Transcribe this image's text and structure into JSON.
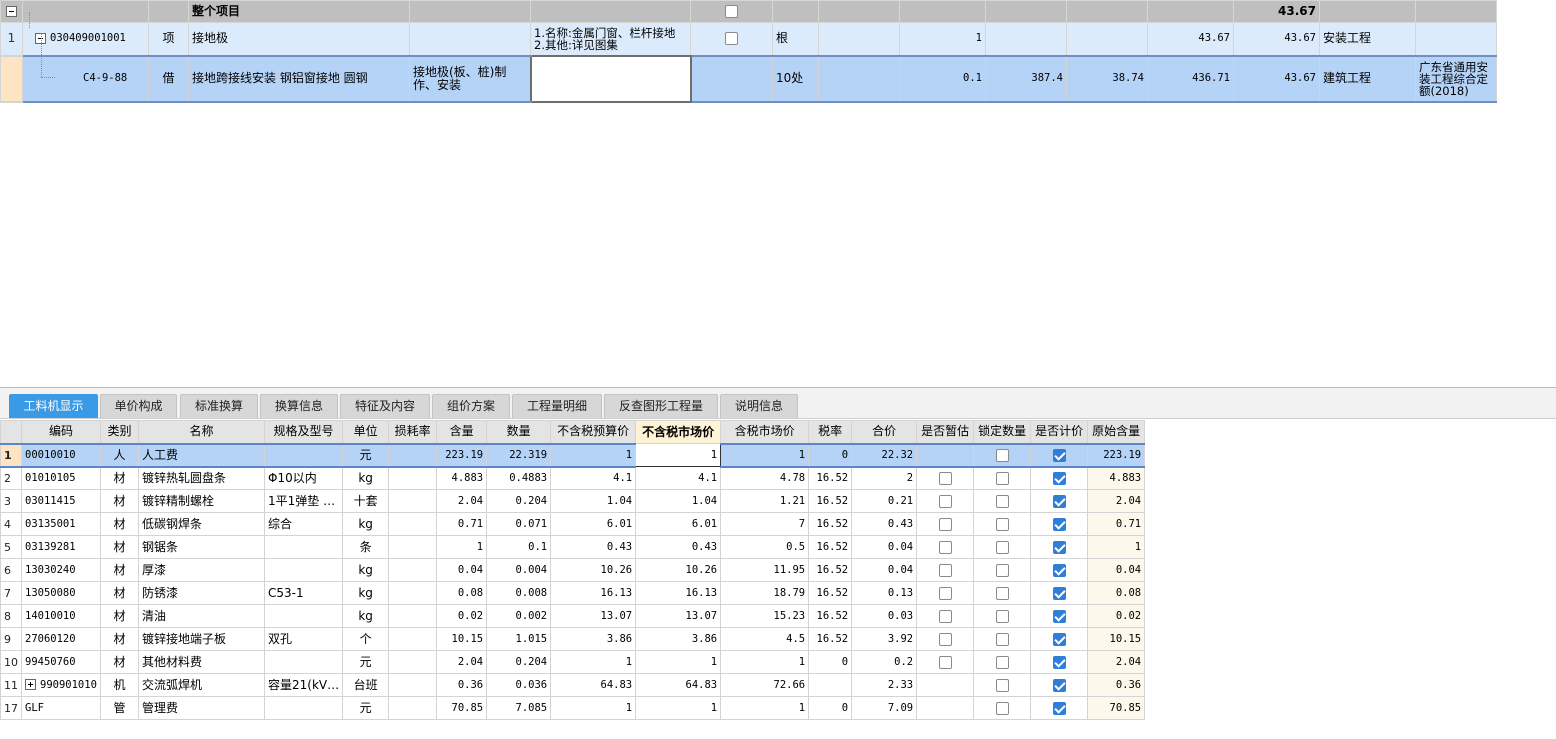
{
  "top_grid": {
    "rows": [
      {
        "index": "",
        "code": "",
        "type": "",
        "name": "整个项目",
        "content": "",
        "feature": "",
        "checked": false,
        "unit": "",
        "c8": "",
        "qty": "",
        "c10": "",
        "c11": "",
        "c12": "",
        "c13": "43.67",
        "category": "",
        "quota": ""
      },
      {
        "index": "1",
        "code": "030409001001",
        "type": "项",
        "name": "接地极",
        "content": "",
        "feature": "1.名称:金属门窗、栏杆接地\n2.其他:详见图集",
        "checked": false,
        "unit": "根",
        "c8": "",
        "qty": "1",
        "c10": "",
        "c11": "",
        "c12": "43.67",
        "c13": "43.67",
        "category": "安装工程",
        "quota": ""
      },
      {
        "index": "",
        "code": "C4-9-88",
        "type": "借",
        "name": "接地跨接线安装 钢铝窗接地 圆钢",
        "content": "接地极(板、桩)制作、安装",
        "feature": "",
        "unit": "10处",
        "c8": "",
        "qty": "0.1",
        "c10": "387.4",
        "c11": "38.74",
        "c12": "436.71",
        "c13": "43.67",
        "category": "建筑工程",
        "quota": "广东省通用安装工程综合定额(2018)"
      }
    ]
  },
  "tabs": [
    "工料机显示",
    "单价构成",
    "标准换算",
    "换算信息",
    "特征及内容",
    "组价方案",
    "工程量明细",
    "反查图形工程量",
    "说明信息"
  ],
  "bottom_grid": {
    "headers": [
      "编码",
      "类别",
      "名称",
      "规格及型号",
      "单位",
      "损耗率",
      "含量",
      "数量",
      "不含税预算价",
      "不含税市场价",
      "含税市场价",
      "税率",
      "合价",
      "是否暂估",
      "锁定数量",
      "是否计价",
      "原始含量"
    ],
    "rows": [
      {
        "idx": "1",
        "code": "00010010",
        "cat": "人",
        "name": "人工费",
        "spec": "",
        "unit": "元",
        "loss": "",
        "content": "223.19",
        "qty": "22.319",
        "budget": "1",
        "market": "1",
        "tax_market": "1",
        "rate": "0",
        "total": "22.32",
        "est": null,
        "lock": false,
        "priced": true,
        "orig": "223.19"
      },
      {
        "idx": "2",
        "code": "01010105",
        "cat": "材",
        "name": "镀锌热轧圆盘条",
        "spec": "Φ10以内",
        "unit": "kg",
        "loss": "",
        "content": "4.883",
        "qty": "0.4883",
        "budget": "4.1",
        "market": "4.1",
        "tax_market": "4.78",
        "rate": "16.52",
        "total": "2",
        "est": false,
        "lock": false,
        "priced": true,
        "orig": "4.883"
      },
      {
        "idx": "3",
        "code": "03011415",
        "cat": "材",
        "name": "镀锌精制螺栓",
        "spec": "1平1弹垫 …",
        "unit": "十套",
        "loss": "",
        "content": "2.04",
        "qty": "0.204",
        "budget": "1.04",
        "market": "1.04",
        "tax_market": "1.21",
        "rate": "16.52",
        "total": "0.21",
        "est": false,
        "lock": false,
        "priced": true,
        "orig": "2.04"
      },
      {
        "idx": "4",
        "code": "03135001",
        "cat": "材",
        "name": "低碳钢焊条",
        "spec": "综合",
        "unit": "kg",
        "loss": "",
        "content": "0.71",
        "qty": "0.071",
        "budget": "6.01",
        "market": "6.01",
        "tax_market": "7",
        "rate": "16.52",
        "total": "0.43",
        "est": false,
        "lock": false,
        "priced": true,
        "orig": "0.71"
      },
      {
        "idx": "5",
        "code": "03139281",
        "cat": "材",
        "name": "钢锯条",
        "spec": "",
        "unit": "条",
        "loss": "",
        "content": "1",
        "qty": "0.1",
        "budget": "0.43",
        "market": "0.43",
        "tax_market": "0.5",
        "rate": "16.52",
        "total": "0.04",
        "est": false,
        "lock": false,
        "priced": true,
        "orig": "1"
      },
      {
        "idx": "6",
        "code": "13030240",
        "cat": "材",
        "name": "厚漆",
        "spec": "",
        "unit": "kg",
        "loss": "",
        "content": "0.04",
        "qty": "0.004",
        "budget": "10.26",
        "market": "10.26",
        "tax_market": "11.95",
        "rate": "16.52",
        "total": "0.04",
        "est": false,
        "lock": false,
        "priced": true,
        "orig": "0.04"
      },
      {
        "idx": "7",
        "code": "13050080",
        "cat": "材",
        "name": "防锈漆",
        "spec": "C53-1",
        "unit": "kg",
        "loss": "",
        "content": "0.08",
        "qty": "0.008",
        "budget": "16.13",
        "market": "16.13",
        "tax_market": "18.79",
        "rate": "16.52",
        "total": "0.13",
        "est": false,
        "lock": false,
        "priced": true,
        "orig": "0.08"
      },
      {
        "idx": "8",
        "code": "14010010",
        "cat": "材",
        "name": "清油",
        "spec": "",
        "unit": "kg",
        "loss": "",
        "content": "0.02",
        "qty": "0.002",
        "budget": "13.07",
        "market": "13.07",
        "tax_market": "15.23",
        "rate": "16.52",
        "total": "0.03",
        "est": false,
        "lock": false,
        "priced": true,
        "orig": "0.02"
      },
      {
        "idx": "9",
        "code": "27060120",
        "cat": "材",
        "name": "镀锌接地端子板",
        "spec": "双孔",
        "unit": "个",
        "loss": "",
        "content": "10.15",
        "qty": "1.015",
        "budget": "3.86",
        "market": "3.86",
        "tax_market": "4.5",
        "rate": "16.52",
        "total": "3.92",
        "est": false,
        "lock": false,
        "priced": true,
        "orig": "10.15"
      },
      {
        "idx": "10",
        "code": "99450760",
        "cat": "材",
        "name": "其他材料费",
        "spec": "",
        "unit": "元",
        "loss": "",
        "content": "2.04",
        "qty": "0.204",
        "budget": "1",
        "market": "1",
        "tax_market": "1",
        "rate": "0",
        "total": "0.2",
        "est": false,
        "lock": false,
        "priced": true,
        "orig": "2.04"
      },
      {
        "idx": "11",
        "code": "990901010",
        "cat": "机",
        "name": "交流弧焊机",
        "spec": "容量21(kV…",
        "unit": "台班",
        "loss": "",
        "content": "0.36",
        "qty": "0.036",
        "budget": "64.83",
        "market": "64.83",
        "tax_market": "72.66",
        "rate": "",
        "total": "2.33",
        "est": null,
        "lock": false,
        "priced": true,
        "orig": "0.36",
        "expandable": true
      },
      {
        "idx": "17",
        "code": "GLF",
        "cat": "管",
        "name": "管理费",
        "spec": "",
        "unit": "元",
        "loss": "",
        "content": "70.85",
        "qty": "7.085",
        "budget": "1",
        "market": "1",
        "tax_market": "1",
        "rate": "0",
        "total": "7.09",
        "est": null,
        "lock": false,
        "priced": true,
        "orig": "70.85"
      }
    ]
  },
  "colors": {
    "accent": "#3b9ae6",
    "selected_row": "#b5d3f7",
    "check_on": "#2f7fd8"
  }
}
